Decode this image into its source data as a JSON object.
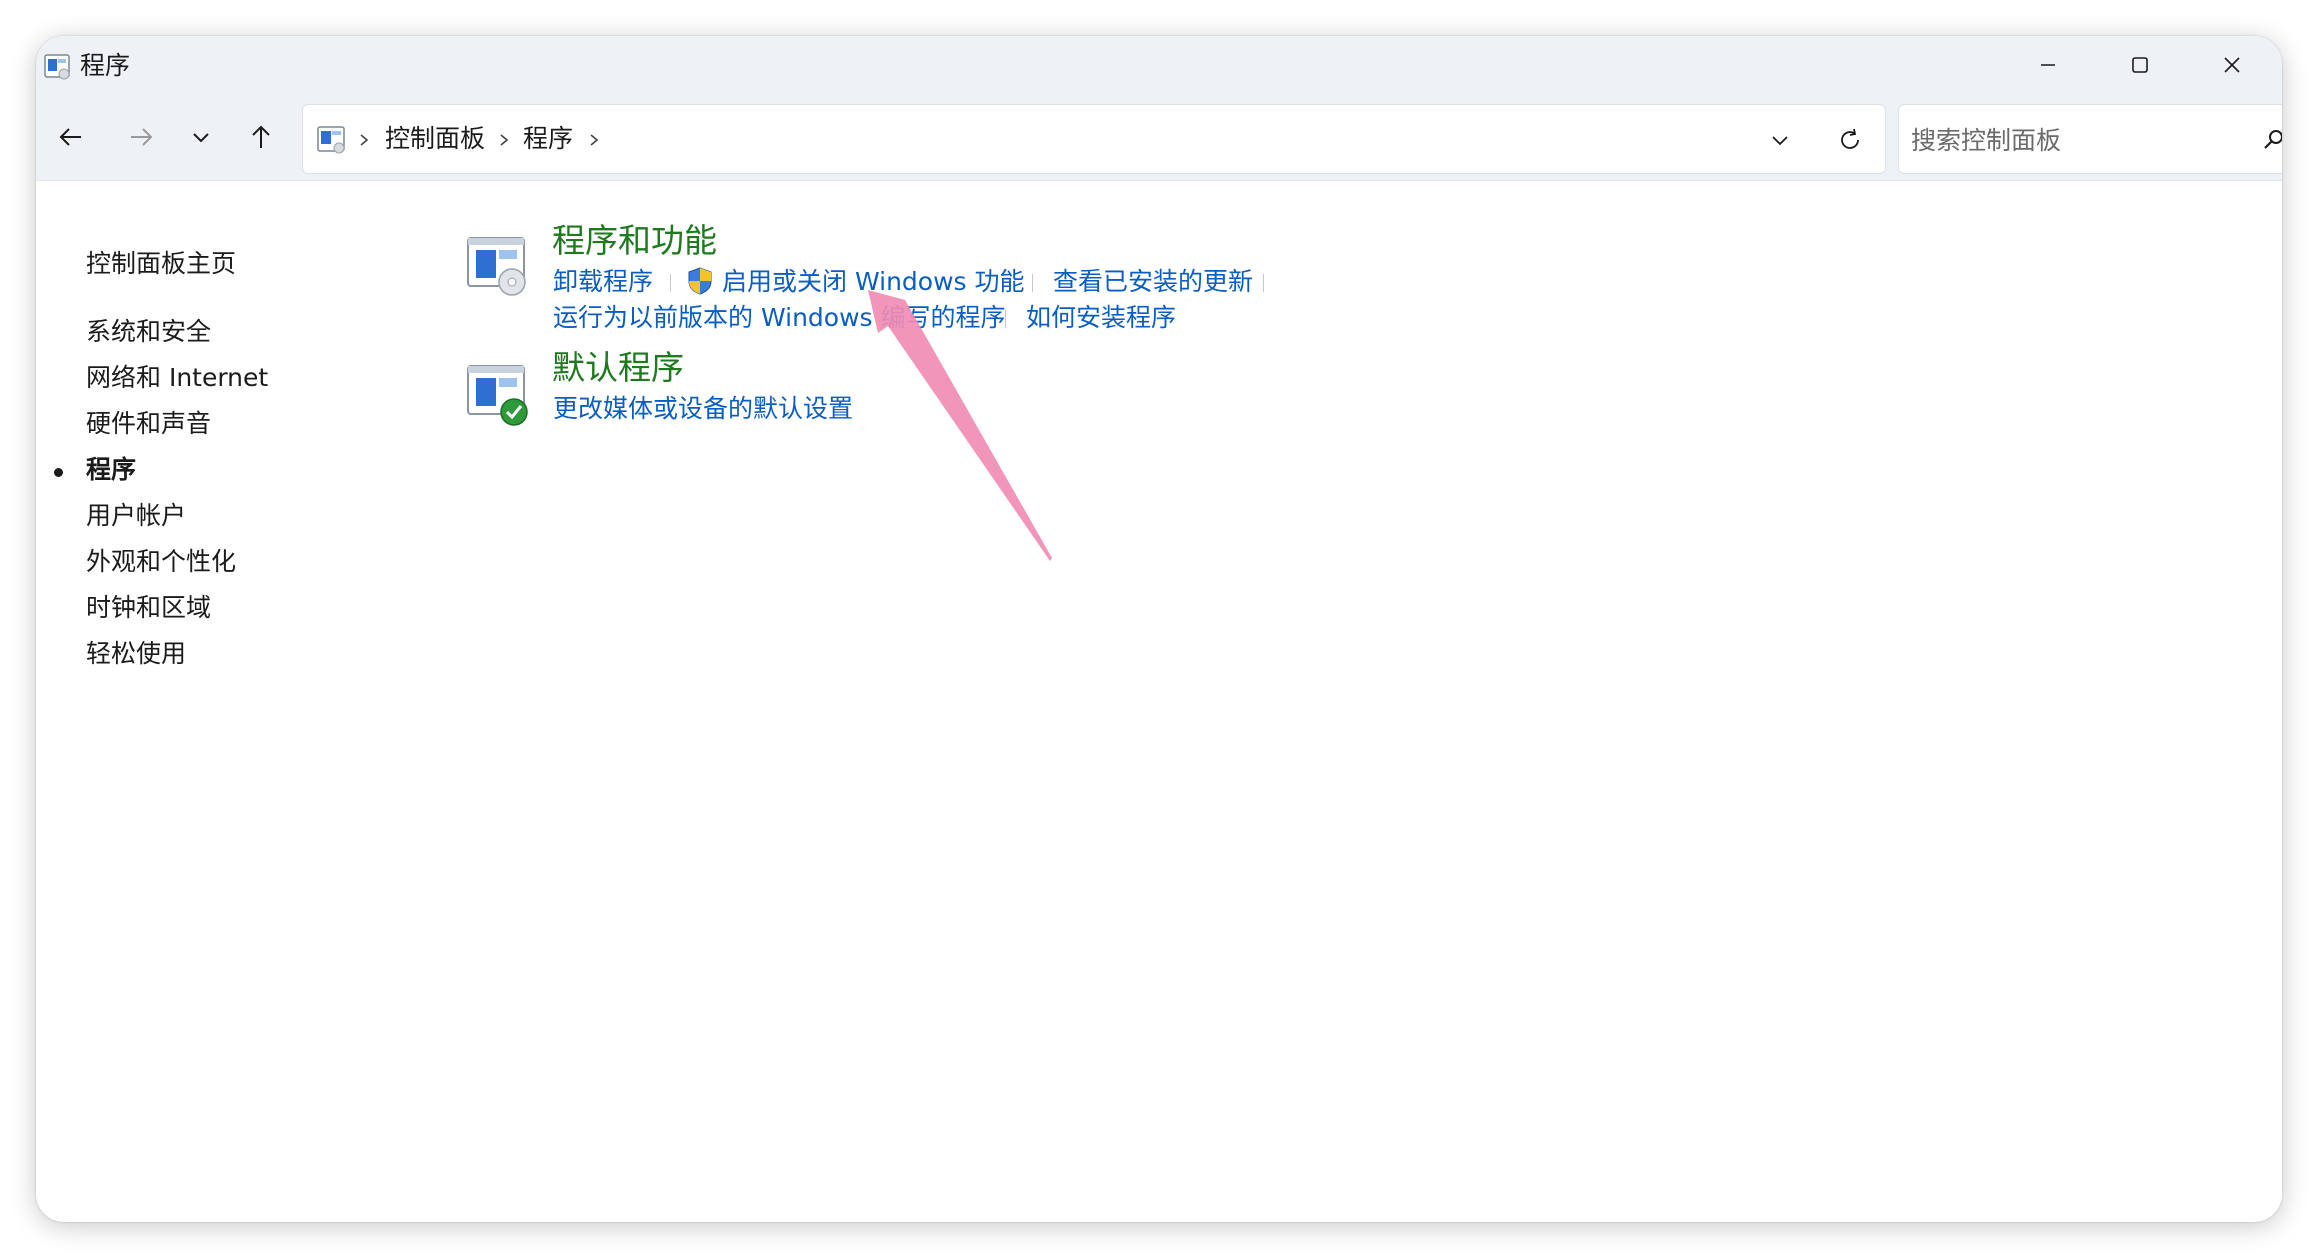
{
  "window": {
    "title": "程序"
  },
  "breadcrumb": {
    "items": [
      "控制面板",
      "程序"
    ]
  },
  "search": {
    "placeholder": "搜索控制面板",
    "value": ""
  },
  "sidebar": {
    "home": "控制面板主页",
    "items": [
      {
        "label": "系统和安全",
        "active": false
      },
      {
        "label": "网络和 Internet",
        "active": false
      },
      {
        "label": "硬件和声音",
        "active": false
      },
      {
        "label": "程序",
        "active": true
      },
      {
        "label": "用户帐户",
        "active": false
      },
      {
        "label": "外观和个性化",
        "active": false
      },
      {
        "label": "时钟和区域",
        "active": false
      },
      {
        "label": "轻松使用",
        "active": false
      }
    ]
  },
  "categories": [
    {
      "title": "程序和功能",
      "icon": "programs-features-icon",
      "links": [
        "卸载程序",
        "启用或关闭 Windows 功能",
        "查看已安装的更新",
        "运行为以前版本的 Windows 编写的程序",
        "如何安装程序"
      ]
    },
    {
      "title": "默认程序",
      "icon": "default-programs-icon",
      "links": [
        "更改媒体或设备的默认设置"
      ]
    }
  ],
  "colors": {
    "category_title": "#1f7a1f",
    "link": "#0a5ec2",
    "annotation_arrow": "#f08cb4",
    "titlebar": "#eef2f7"
  }
}
